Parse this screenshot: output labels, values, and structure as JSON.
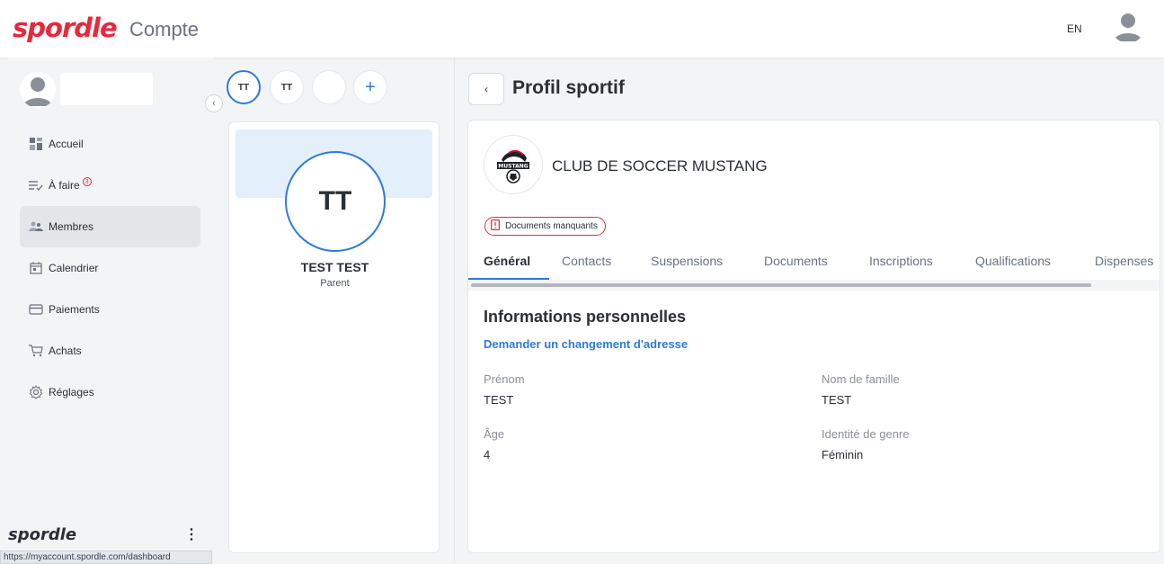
{
  "header": {
    "logo_text": "spordle",
    "app_title": "Compte",
    "language": "EN",
    "icons": {
      "user": "user-avatar-icon"
    }
  },
  "sidebar": {
    "collapse_glyph": "‹",
    "items": [
      {
        "label": "Accueil",
        "icon": "dashboard-icon"
      },
      {
        "label": "À faire",
        "icon": "checklist-icon",
        "badge": "3"
      },
      {
        "label": "Membres",
        "icon": "members-icon",
        "active": true
      },
      {
        "label": "Calendrier",
        "icon": "calendar-icon"
      },
      {
        "label": "Paiements",
        "icon": "credit-card-icon"
      },
      {
        "label": "Achats",
        "icon": "cart-icon"
      },
      {
        "label": "Réglages",
        "icon": "gear-icon"
      }
    ],
    "footer_logo": "spordle",
    "footer_more": "⋮",
    "status_url": "https://myaccount.spordle.com/dashboard"
  },
  "members": {
    "chips": [
      {
        "initials": "TT",
        "active": true
      },
      {
        "initials": "TT",
        "active": false
      },
      {
        "initials": "",
        "active": false
      }
    ],
    "add_glyph": "+",
    "selected": {
      "initials": "TT",
      "name": "TEST TEST",
      "role": "Parent"
    }
  },
  "main": {
    "back_glyph": "‹",
    "page_title": "Profil sportif",
    "club_name": "CLUB DE SOCCER MUSTANG",
    "club_logo_text": "MUSTANG",
    "missing_docs_badge": "Documents manquants",
    "tabs": [
      {
        "label": "Général",
        "active": true
      },
      {
        "label": "Contacts"
      },
      {
        "label": "Suspensions"
      },
      {
        "label": "Documents"
      },
      {
        "label": "Inscriptions"
      },
      {
        "label": "Qualifications"
      },
      {
        "label": "Dispenses"
      }
    ],
    "section_title": "Informations personnelles",
    "change_address_link": "Demander un changement d'adresse",
    "fields": {
      "first_name_label": "Prénom",
      "first_name_value": "TEST",
      "last_name_label": "Nom de famille",
      "last_name_value": "TEST",
      "age_label": "Âge",
      "age_value": "4",
      "gender_label": "Identité de genre",
      "gender_value": "Féminin"
    }
  },
  "colors": {
    "brand_red": "#e8283b",
    "accent_blue": "#2f7bd6",
    "active_nav_bg": "#e3e5e9"
  }
}
